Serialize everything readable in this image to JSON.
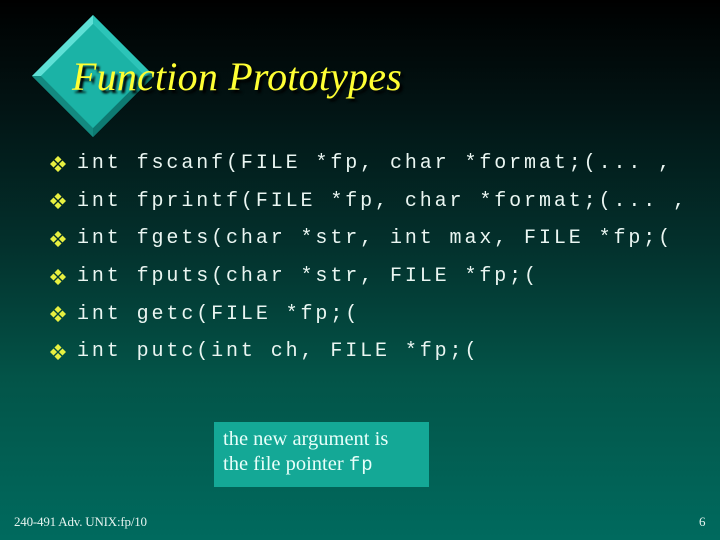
{
  "slide": {
    "title": "Function Prototypes",
    "bullet_icon": "four-dot-diamond-bullet-icon",
    "bullets": [
      {
        "text": "int fscanf(FILE *fp, char *format;(... ,"
      },
      {
        "text": "int fprintf(FILE *fp, char *format;(... ,"
      },
      {
        "text": "int fgets(char *str, int max, FILE *fp;("
      },
      {
        "text": "int fputs(char *str, FILE *fp;("
      },
      {
        "text": "int getc(FILE *fp;("
      },
      {
        "text": "int putc(int ch, FILE *fp;("
      }
    ],
    "callout": {
      "line1": "the new argument is",
      "line2_prefix": "the file pointer ",
      "line2_code": "fp"
    },
    "footer": {
      "left": "240-491 Adv. UNIX:fp/10",
      "page_number": "6"
    },
    "colors": {
      "title": "#ffff33",
      "diamond": "#1fb5aa",
      "callout_bg": "#14a896",
      "bullet": "#e8f040",
      "text": "#eaf6f2",
      "background_top": "#000000",
      "background_bottom": "#006a5e"
    }
  }
}
